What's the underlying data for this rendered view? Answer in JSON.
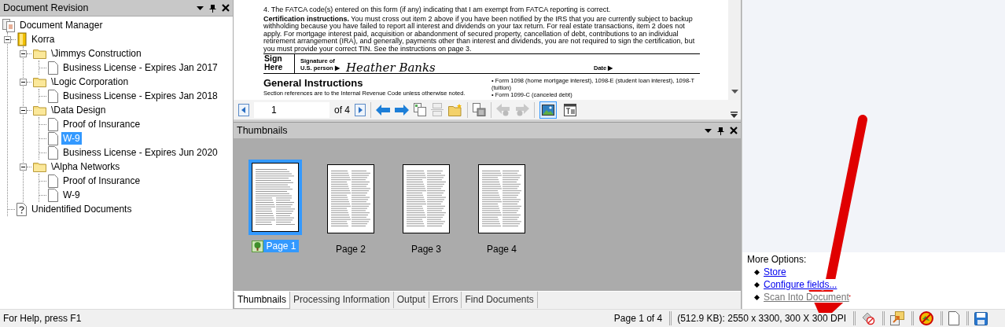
{
  "left_panel": {
    "title": "Document Revision"
  },
  "tree": {
    "label": "Document Manager",
    "kind": "root",
    "children": [
      {
        "label": "Korra",
        "kind": "cabinet",
        "expanded": true,
        "children": [
          {
            "label": "\\Jimmys Construction",
            "kind": "folder",
            "expanded": true,
            "children": [
              {
                "label": "Business License - Expires Jan 2017",
                "kind": "document",
                "selected": false
              }
            ]
          },
          {
            "label": "\\Logic Corporation",
            "kind": "folder",
            "expanded": true,
            "children": [
              {
                "label": "Business License - Expires Jan 2018",
                "kind": "document",
                "selected": false
              }
            ]
          },
          {
            "label": "\\Data Design",
            "kind": "folder",
            "expanded": true,
            "children": [
              {
                "label": "Proof of Insurance",
                "kind": "document",
                "selected": false
              },
              {
                "label": "W-9",
                "kind": "document",
                "selected": true
              },
              {
                "label": "Business License - Expires Jun 2020",
                "kind": "document",
                "selected": false
              }
            ]
          },
          {
            "label": "\\Alpha Networks",
            "kind": "folder",
            "expanded": true,
            "children": [
              {
                "label": "Proof of Insurance",
                "kind": "document",
                "selected": false
              },
              {
                "label": "W-9",
                "kind": "document",
                "selected": false
              }
            ]
          }
        ]
      },
      {
        "label": "Unidentified Documents",
        "kind": "unknown"
      }
    ]
  },
  "document": {
    "lines": [
      "4. The FATCA code(s) entered on this form (if any) indicating that I am exempt from FATCA reporting is correct."
    ],
    "paragraph": "**Certification instructions.** You must cross out item 2 above if you have been notified by the IRS that you are currently subject to backup withholding because you have failed to report all interest and dividends on your tax return. For real estate transactions, item 2 does not apply. For mortgage interest paid, acquisition or abandonment of secured property, cancellation of debt, contributions to an individual retirement arrangement (IRA), and generally, payments other than interest and dividends, you are not required to sign the certification, but you must provide your correct TIN. See the instructions on page 3.",
    "sign_label": "Sign Here",
    "signature_label": "Signature of U.S. person ▶",
    "signature": "Heather Banks",
    "date_label": "Date ▶",
    "heading": "General Instructions",
    "note": "Section references are to the Internal Revenue Code unless otherwise noted.",
    "bullets": [
      "• Form 1098 (home mortgage interest), 1098-E (student loan interest), 1098-T (tuition)",
      "• Form 1099-C (canceled debt)"
    ]
  },
  "toolbar": {
    "page": "1",
    "of": "of 4",
    "image_view_selected": true
  },
  "thumbnails": {
    "title": "Thumbnails",
    "items": [
      {
        "label": "Page 1",
        "selected": true
      },
      {
        "label": "Page 2",
        "selected": false
      },
      {
        "label": "Page 3",
        "selected": false
      },
      {
        "label": "Page 4",
        "selected": false
      }
    ]
  },
  "tabs": [
    {
      "label": "Thumbnails",
      "selected": true
    },
    {
      "label": "Processing Information",
      "selected": false
    },
    {
      "label": "Output",
      "selected": false
    },
    {
      "label": "Errors",
      "selected": false
    },
    {
      "label": "Find Documents",
      "selected": false
    }
  ],
  "more_options": {
    "title": "More Options:",
    "links": [
      {
        "label": "Store",
        "disabled": false
      },
      {
        "label": "Configure fields...",
        "disabled": false
      },
      {
        "label": "Scan Into Document",
        "disabled": true
      }
    ]
  },
  "status_bar": {
    "help": "For Help, press F1",
    "page": "Page 1 of 4",
    "info": "(512.9 KB): 2550 x 3300, 300 X 300 DPI"
  }
}
